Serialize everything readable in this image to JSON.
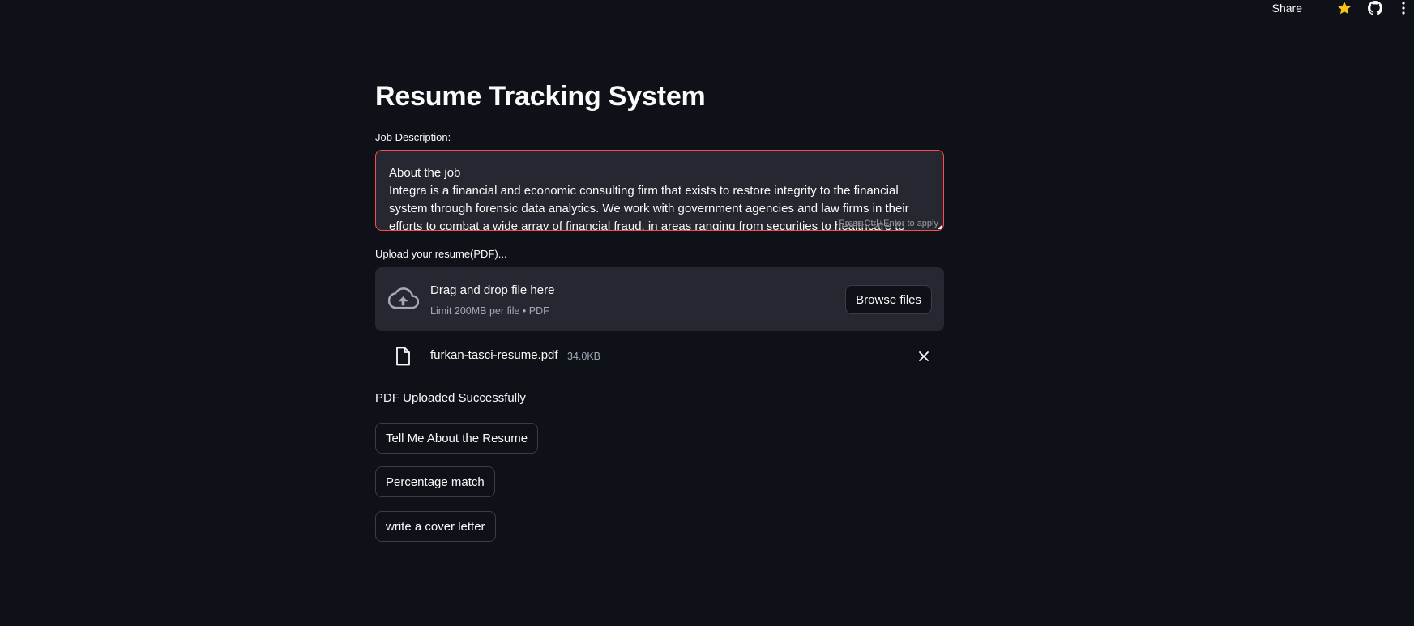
{
  "toolbar": {
    "share_label": "Share",
    "star_icon": "star-icon",
    "github_icon": "github-icon",
    "menu_icon": "kebab-menu-icon",
    "star_color": "#f9c513"
  },
  "page": {
    "title": "Resume Tracking System"
  },
  "job_description": {
    "label": "Job Description:",
    "value": "About the job\nIntegra is a financial and economic consulting firm that exists to restore integrity to the financial system through forensic data analytics. We work with government agencies and law firms in their efforts to combat a wide array of financial fraud, in areas ranging from securities to healthcare to",
    "hint": "Press Ctrl+Enter to apply",
    "border_color": "#ff4b4b"
  },
  "uploader": {
    "label": "Upload your resume(PDF)...",
    "dropzone_title": "Drag and drop file here",
    "dropzone_subtitle": "Limit 200MB per file • PDF",
    "browse_label": "Browse files",
    "icon": "cloud-upload-icon"
  },
  "uploaded_file": {
    "name": "furkan-tasci-resume.pdf",
    "size": "34.0KB",
    "icon": "file-icon",
    "remove_icon": "close-icon"
  },
  "status": {
    "message": "PDF Uploaded Successfully"
  },
  "actions": {
    "tell_me": "Tell Me About the Resume",
    "percentage": "Percentage match",
    "cover_letter": "write a cover letter"
  }
}
